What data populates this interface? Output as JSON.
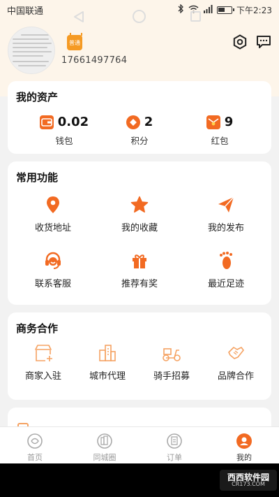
{
  "status": {
    "carrier": "中国联通",
    "time": "下午2:23"
  },
  "profile": {
    "vip_label": "普通",
    "phone": "17661497764"
  },
  "assets": {
    "title": "我的资产",
    "items": [
      {
        "value": "0.02",
        "label": "钱包"
      },
      {
        "value": "2",
        "label": "积分"
      },
      {
        "value": "9",
        "label": "红包"
      }
    ]
  },
  "functions": {
    "title": "常用功能",
    "items": [
      {
        "label": "收货地址",
        "icon": "location-icon"
      },
      {
        "label": "我的收藏",
        "icon": "star-icon"
      },
      {
        "label": "我的发布",
        "icon": "paper-plane-icon"
      },
      {
        "label": "联系客服",
        "icon": "headset-icon"
      },
      {
        "label": "推荐有奖",
        "icon": "gift-icon"
      },
      {
        "label": "最近足迹",
        "icon": "footprint-icon"
      }
    ]
  },
  "business": {
    "title": "商务合作",
    "items": [
      {
        "label": "商家入驻",
        "icon": "shop-add-icon"
      },
      {
        "label": "城市代理",
        "icon": "city-building-icon"
      },
      {
        "label": "骑手招募",
        "icon": "scooter-icon"
      },
      {
        "label": "品牌合作",
        "icon": "handshake-icon"
      }
    ]
  },
  "tabs": [
    {
      "label": "首页",
      "icon": "home-icon",
      "active": false
    },
    {
      "label": "同城圈",
      "icon": "city-circle-icon",
      "active": false
    },
    {
      "label": "订单",
      "icon": "order-icon",
      "active": false
    },
    {
      "label": "我的",
      "icon": "profile-icon",
      "active": true
    }
  ],
  "watermark": {
    "brand": "西西软件园",
    "url": "CR173.COM"
  },
  "colors": {
    "accent": "#f26a22",
    "header_bg": "#fdf5ea",
    "page_bg": "#f2f2f2"
  }
}
